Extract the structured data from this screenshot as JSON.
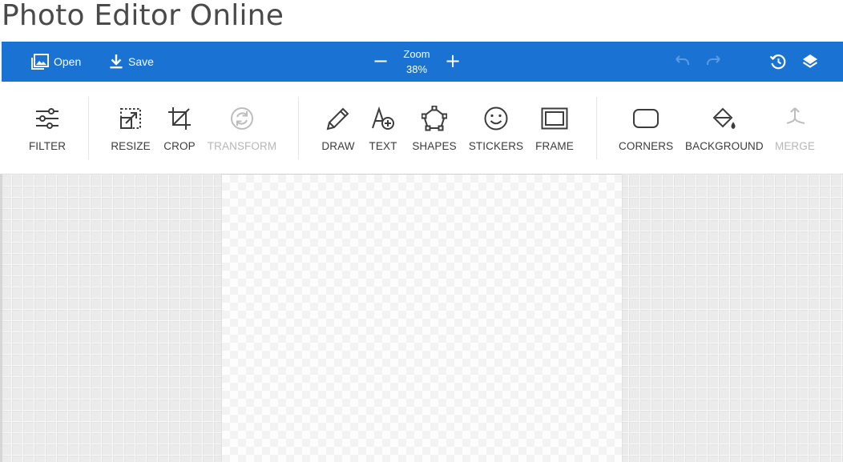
{
  "page": {
    "title": "Photo Editor Online"
  },
  "topbar": {
    "open_label": "Open",
    "save_label": "Save",
    "zoom_label": "Zoom",
    "zoom_value": "38%",
    "zoom_minus": "−",
    "zoom_plus": "+",
    "colors": {
      "background": "#1a73d3",
      "text": "#ffffff",
      "disabled_icon": "#5a9ae2"
    }
  },
  "tools": {
    "filter": "FILTER",
    "resize": "RESIZE",
    "crop": "CROP",
    "transform": "TRANSFORM",
    "draw": "DRAW",
    "text": "TEXT",
    "shapes": "SHAPES",
    "stickers": "STICKERS",
    "frame": "FRAME",
    "corners": "CORNERS",
    "background": "BACKGROUND",
    "merge": "MERGE"
  },
  "tool_states": {
    "transform": "disabled",
    "merge": "disabled"
  },
  "icons": {
    "open": "image-icon",
    "save": "download-icon",
    "undo": "undo-icon",
    "redo": "redo-icon",
    "history": "history-icon",
    "layers": "layers-icon",
    "filter": "sliders-icon",
    "resize": "resize-icon",
    "crop": "crop-icon",
    "transform": "rotate-icon",
    "draw": "pencil-icon",
    "text": "text-add-icon",
    "shapes": "pentagon-icon",
    "stickers": "smiley-icon",
    "frame": "frame-icon",
    "corners": "rounded-rect-icon",
    "background": "paint-bucket-icon",
    "merge": "merge-icon"
  }
}
